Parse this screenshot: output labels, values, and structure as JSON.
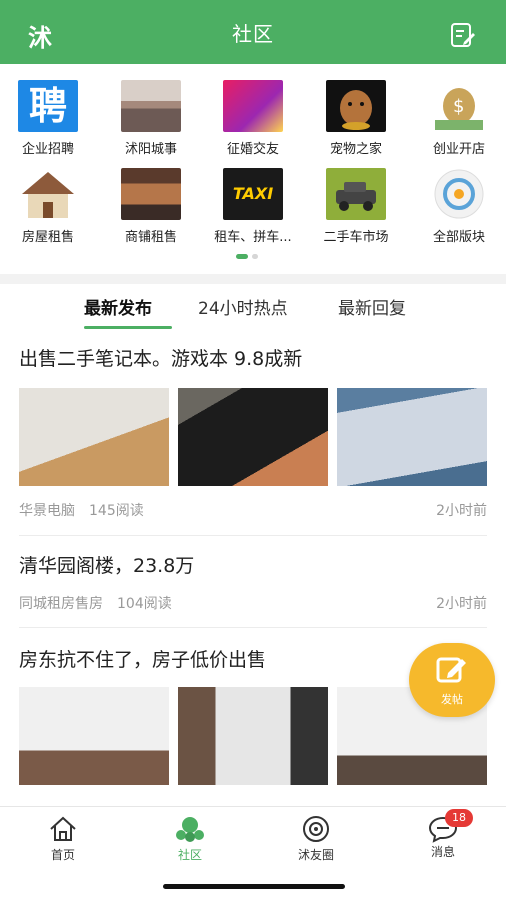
{
  "header": {
    "logo": "沭",
    "title": "社区"
  },
  "categories": [
    {
      "label": "企业招聘",
      "icon": "recruit-icon"
    },
    {
      "label": "沭阳城事",
      "icon": "city-news-icon"
    },
    {
      "label": "征婚交友",
      "icon": "dating-icon"
    },
    {
      "label": "宠物之家",
      "icon": "pet-icon"
    },
    {
      "label": "创业开店",
      "icon": "business-icon"
    },
    {
      "label": "房屋租售",
      "icon": "house-icon"
    },
    {
      "label": "商铺租售",
      "icon": "shop-icon"
    },
    {
      "label": "租车、拼车...",
      "icon": "taxi-icon"
    },
    {
      "label": "二手车市场",
      "icon": "used-car-icon"
    },
    {
      "label": "全部版块",
      "icon": "all-boards-icon"
    }
  ],
  "tabs": [
    {
      "label": "最新发布",
      "active": true
    },
    {
      "label": "24小时热点",
      "active": false
    },
    {
      "label": "最新回复",
      "active": false
    }
  ],
  "posts": [
    {
      "title": "出售二手笔记本。游戏本 9.8成新",
      "author": "华景电脑",
      "reads": "145阅读",
      "time": "2小时前"
    },
    {
      "title": "清华园阁楼，23.8万",
      "author": "同城租房售房",
      "reads": "104阅读",
      "time": "2小时前"
    },
    {
      "title": "房东抗不住了，房子低价出售",
      "author": "",
      "reads": "",
      "time": ""
    }
  ],
  "recruit_glyph": "聘",
  "taxi_text": "TAXI",
  "fab": {
    "label": "发帖"
  },
  "bottom_nav": [
    {
      "label": "首页"
    },
    {
      "label": "社区"
    },
    {
      "label": "沭友圈"
    },
    {
      "label": "消息",
      "badge": "18"
    }
  ],
  "colors": {
    "primary": "#4caf63",
    "fab": "#f6b92c",
    "badge": "#e53935"
  }
}
